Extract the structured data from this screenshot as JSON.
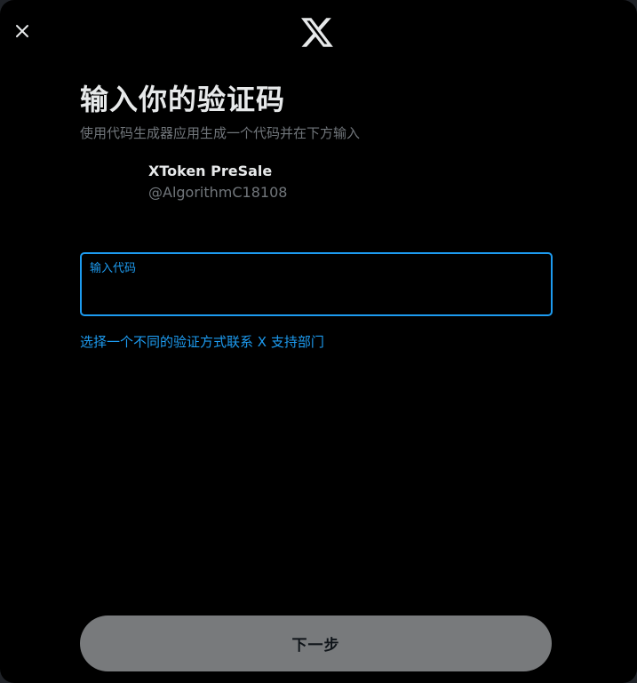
{
  "header": {
    "close_icon": "close-icon",
    "logo_icon": "x-logo-icon"
  },
  "main": {
    "title": "输入你的验证码",
    "subtitle": "使用代码生成器应用生成一个代码并在下方输入"
  },
  "account": {
    "name": "XToken PreSale",
    "handle": "@AlgorithmC18108"
  },
  "code_field": {
    "label": "输入代码",
    "value": ""
  },
  "links": {
    "alt_method": "选择一个不同的验证方式",
    "support": "联系 X 支持部门"
  },
  "footer": {
    "next_label": "下一步"
  },
  "colors": {
    "background": "#000000",
    "accent": "#1d9bf0",
    "primary_text": "#e7e9ea",
    "secondary_text": "#71767b",
    "disabled_button": "#787a7c"
  }
}
